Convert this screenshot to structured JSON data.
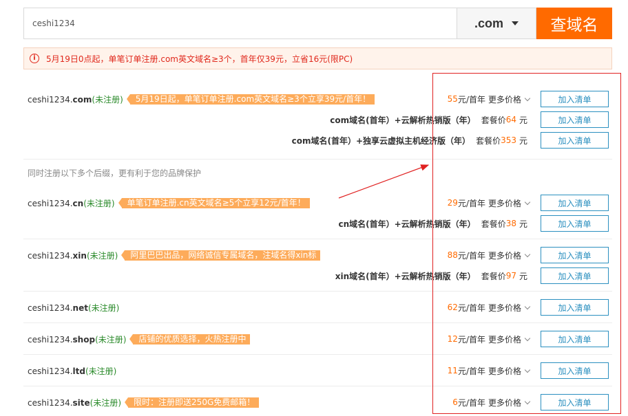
{
  "search": {
    "value": "ceshi1234",
    "tld": ".com",
    "button_label": "查域名"
  },
  "notice": {
    "icon": "info-icon",
    "text": "5月19日0点起，单笔订单注册.com英文域名≥3个，首年仅39元，立省16元(限PC)"
  },
  "common": {
    "status": "(未注册)",
    "price_unit": "元/首年",
    "more_price": "更多价格",
    "add_label": "加入清单",
    "pkg_label": "套餐价",
    "yuan": "元"
  },
  "hint": "同时注册以下多个后缀，更有利于您的品牌保护",
  "domains": [
    {
      "prefix": "ceshi1234.",
      "tld": "com",
      "promo": "5月19日起，单笔订单注册.com英文域名≥3个立享39元/首年！",
      "price": "55",
      "bundles": [
        {
          "name": "com域名(首年）+云解析热销版（年）",
          "price": "64"
        },
        {
          "name": "com域名(首年）+独享云虚拟主机经济版（年）",
          "price": "353"
        }
      ]
    },
    {
      "prefix": "ceshi1234.",
      "tld": "cn",
      "promo": "单笔订单注册.cn英文域名≥5个立享12元/首年！",
      "price": "29",
      "bundles": [
        {
          "name": "cn域名(首年）+云解析热销版（年）",
          "price": "38"
        }
      ]
    },
    {
      "prefix": "ceshi1234.",
      "tld": "xin",
      "promo": "阿里巴巴出品，网络诚信专属域名，注域名得xin标",
      "price": "88",
      "bundles": [
        {
          "name": "xin域名(首年）+云解析热销版（年）",
          "price": "97"
        }
      ]
    },
    {
      "prefix": "ceshi1234.",
      "tld": "net",
      "promo": "",
      "price": "62",
      "bundles": []
    },
    {
      "prefix": "ceshi1234.",
      "tld": "shop",
      "promo": "店铺的优质选择，火热注册中",
      "price": "12",
      "bundles": []
    },
    {
      "prefix": "ceshi1234.",
      "tld": "ltd",
      "promo": "",
      "price": "11",
      "bundles": []
    },
    {
      "prefix": "ceshi1234.",
      "tld": "site",
      "promo": "限时：注册即送250G免费邮箱！",
      "price": "6",
      "bundles": []
    }
  ],
  "colors": {
    "accent": "#ff6a00",
    "promo_tag": "#fdab5a",
    "status_green": "#2a8a2a",
    "button_blue": "#2a8fbf",
    "annotation_red": "#e02020"
  }
}
